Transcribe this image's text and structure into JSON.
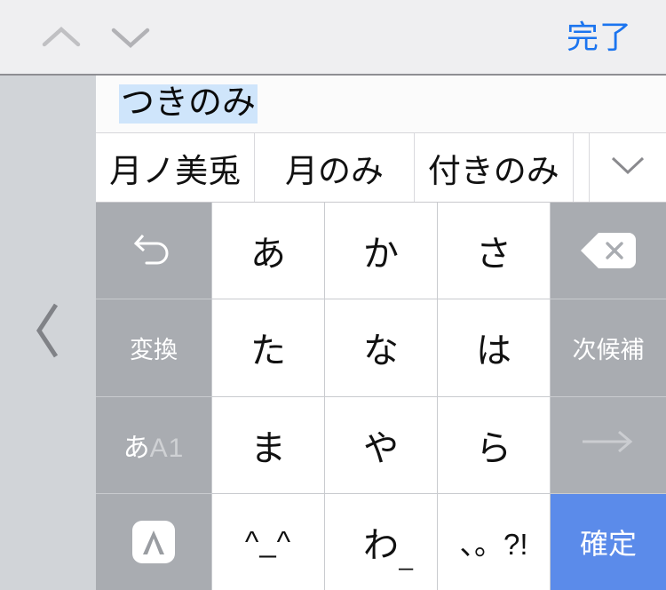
{
  "toolbar": {
    "prev_icon": "chevron-up-icon",
    "next_icon": "chevron-down-icon",
    "done_label": "完了"
  },
  "sidebar": {
    "collapse_icon": "chevron-left-icon"
  },
  "input": {
    "composition_text": "つきのみ",
    "highlight_color": "#cfe5fb"
  },
  "candidates": {
    "items": [
      {
        "label": "月ノ美兎"
      },
      {
        "label": "月のみ"
      },
      {
        "label": "付きのみ"
      }
    ],
    "expand_icon": "chevron-down-icon"
  },
  "keyboard": {
    "rows": [
      {
        "keys": [
          {
            "name": "undo-key",
            "label": "",
            "icon": "undo-arrow-icon",
            "style": "fn"
          },
          {
            "name": "key-a",
            "label": "あ",
            "icon": "",
            "style": "kana"
          },
          {
            "name": "key-ka",
            "label": "か",
            "icon": "",
            "style": "kana"
          },
          {
            "name": "key-sa",
            "label": "さ",
            "icon": "",
            "style": "kana"
          },
          {
            "name": "backspace-key",
            "label": "",
            "icon": "backspace-icon",
            "style": "fn"
          }
        ]
      },
      {
        "keys": [
          {
            "name": "convert-key",
            "label": "変換",
            "icon": "",
            "style": "fn"
          },
          {
            "name": "key-ta",
            "label": "た",
            "icon": "",
            "style": "kana"
          },
          {
            "name": "key-na",
            "label": "な",
            "icon": "",
            "style": "kana"
          },
          {
            "name": "key-ha",
            "label": "は",
            "icon": "",
            "style": "kana"
          },
          {
            "name": "next-candidate-key",
            "label": "次候補",
            "icon": "",
            "style": "fn"
          }
        ]
      },
      {
        "keys": [
          {
            "name": "input-mode-key",
            "label": "",
            "primary": "あ",
            "secondary": "A1",
            "icon": "",
            "style": "mode"
          },
          {
            "name": "key-ma",
            "label": "ま",
            "icon": "",
            "style": "kana"
          },
          {
            "name": "key-ya",
            "label": "や",
            "icon": "",
            "style": "kana"
          },
          {
            "name": "key-ra",
            "label": "ら",
            "icon": "",
            "style": "kana"
          },
          {
            "name": "cursor-right-key",
            "label": "",
            "icon": "arrow-right-icon",
            "style": "fn-dim"
          }
        ]
      },
      {
        "keys": [
          {
            "name": "keyboard-switch-key",
            "label": "",
            "icon": "atok-logo-icon",
            "style": "fn"
          },
          {
            "name": "key-emoticon",
            "label": "^_^",
            "icon": "",
            "style": "emoticon"
          },
          {
            "name": "key-wa",
            "label": "わ",
            "sub": "_",
            "icon": "",
            "style": "wa"
          },
          {
            "name": "key-punctuation",
            "label": "、。?!",
            "icon": "",
            "style": "punct"
          },
          {
            "name": "confirm-key",
            "label": "確定",
            "icon": "",
            "style": "confirm"
          }
        ]
      }
    ]
  },
  "colors": {
    "toolbar_bg": "#efeff1",
    "sidebar_bg": "#d1d4d8",
    "function_key_bg": "#a9acb1",
    "confirm_key_bg": "#5b8bea",
    "done_text": "#1b74ef"
  }
}
